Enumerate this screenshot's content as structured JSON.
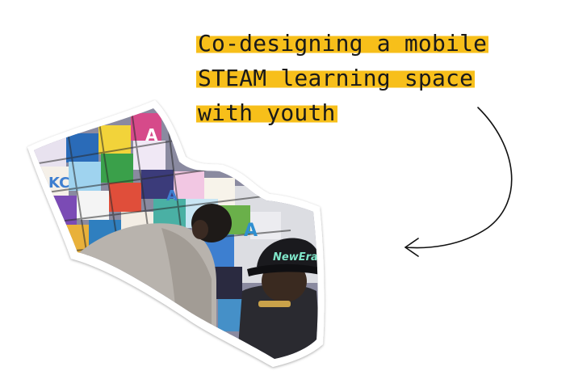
{
  "headline": {
    "lines": [
      "Co-designing a mobile",
      "STEAM learning space",
      "with youth"
    ]
  },
  "photo": {
    "cap_text": "NewEra",
    "quilt_letters": [
      "A",
      "KC",
      "A",
      "A"
    ]
  },
  "colors": {
    "highlight": "#f7bf1a",
    "text": "#1a1a1a",
    "arrow": "#111111",
    "cap_text": "#7fe6c9"
  },
  "icons": {
    "arrow": "curved-arrow-icon"
  }
}
